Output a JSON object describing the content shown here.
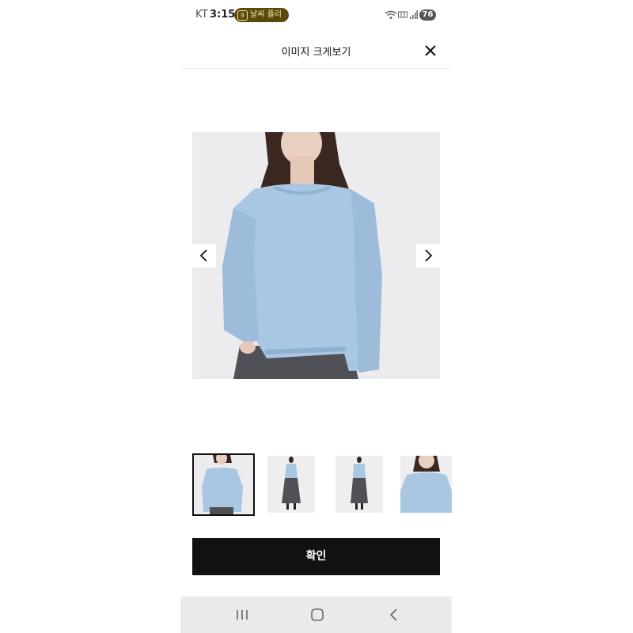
{
  "status_bar": {
    "carrier": "KT",
    "time": "3:15",
    "weather_pill_number": "9",
    "weather_pill_text": "날씨 플리",
    "battery": "76"
  },
  "header": {
    "title": "이미지 크게보기"
  },
  "main_image": {
    "description_icon": "product-photo-blue-sweater"
  },
  "thumbnails": [
    {
      "name": "thumb-1",
      "selected": true
    },
    {
      "name": "thumb-2",
      "selected": false
    },
    {
      "name": "thumb-3",
      "selected": false
    },
    {
      "name": "thumb-4",
      "selected": false
    }
  ],
  "confirm_button": {
    "label": "확인"
  },
  "colors": {
    "accent": "#111111",
    "sweater": "#a9c7e3",
    "skirt": "#4f5156",
    "weather_pill": "#5a4a0a"
  }
}
